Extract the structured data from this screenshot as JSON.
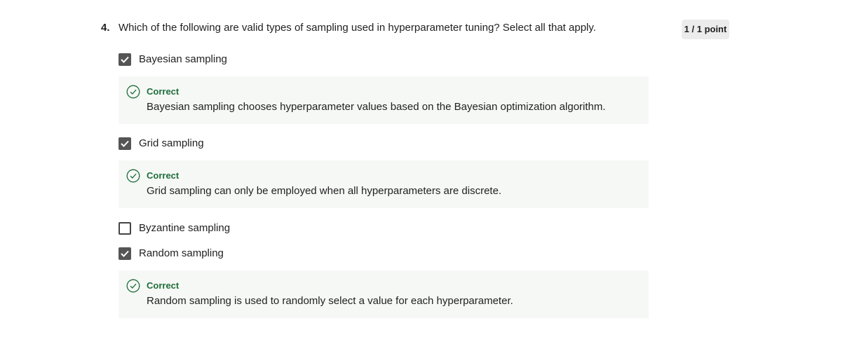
{
  "question": {
    "number": "4.",
    "text": "Which of the following are valid types of sampling used in hyperparameter tuning? Select all that apply.",
    "points": "1 / 1 point"
  },
  "options": [
    {
      "label": "Bayesian sampling",
      "checked": true
    },
    {
      "label": "Grid sampling",
      "checked": true
    },
    {
      "label": "Byzantine sampling",
      "checked": false
    },
    {
      "label": "Random sampling",
      "checked": true
    }
  ],
  "feedback": [
    {
      "status": "Correct",
      "text": "Bayesian sampling chooses hyperparameter values based on the Bayesian optimization algorithm.",
      "icon": "check-circle-icon"
    },
    {
      "status": "Correct",
      "text": "Grid sampling can only be employed when all hyperparameters are discrete.",
      "icon": "check-circle-icon"
    },
    {
      "status": "Correct",
      "text": "Random sampling is used to randomly select a value for each hyperparameter.",
      "icon": "check-circle-icon"
    }
  ],
  "colors": {
    "correct": "#1e6e3a",
    "checkbox_checked": "#555555",
    "feedback_bg": "#f6f8f6",
    "badge_bg": "#ececec"
  }
}
